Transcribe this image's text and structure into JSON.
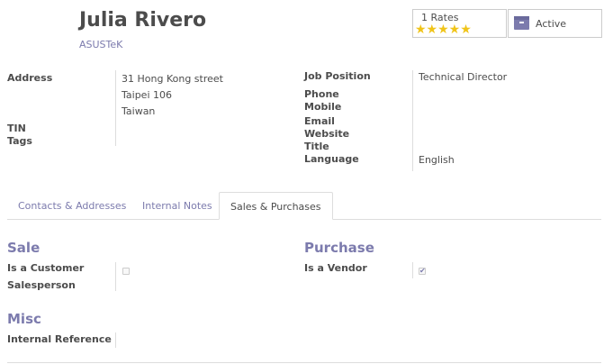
{
  "header": {
    "name": "Julia Rivero",
    "company": "ASUSTeK"
  },
  "stats": {
    "rates_label": "1 Rates",
    "stars": "★★★★★",
    "active_label": "Active"
  },
  "left_fields": {
    "address_label": "Address",
    "address_line1": "31 Hong Kong street",
    "address_line2": "Taipei 106",
    "address_line3": "Taiwan",
    "tin_label": "TIN",
    "tags_label": "Tags"
  },
  "right_fields": {
    "job_position_label": "Job Position",
    "job_position_value": "Technical Director",
    "phone_label": "Phone",
    "mobile_label": "Mobile",
    "email_label": "Email",
    "website_label": "Website",
    "title_label": "Title",
    "language_label": "Language",
    "language_value": "English"
  },
  "tabs": [
    {
      "label": "Contacts & Addresses"
    },
    {
      "label": "Internal Notes"
    },
    {
      "label": "Sales & Purchases"
    }
  ],
  "sale": {
    "heading": "Sale",
    "is_customer_label": "Is a Customer",
    "is_customer": false,
    "salesperson_label": "Salesperson"
  },
  "purchase": {
    "heading": "Purchase",
    "is_vendor_label": "Is a Vendor",
    "is_vendor": true,
    "checkmark": "✔"
  },
  "misc": {
    "heading": "Misc",
    "internal_reference_label": "Internal Reference"
  }
}
